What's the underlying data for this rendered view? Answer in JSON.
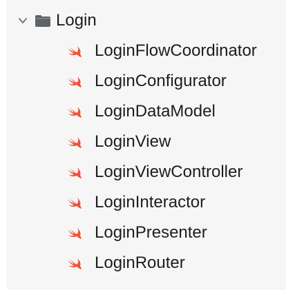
{
  "navigator": {
    "folder": {
      "label": "Login",
      "expanded": true,
      "icon": "folder-icon",
      "disclosure_icon": "chevron-down-icon"
    },
    "files": [
      {
        "label": "LoginFlowCoordinator",
        "icon": "swift-icon"
      },
      {
        "label": "LoginConfigurator",
        "icon": "swift-icon"
      },
      {
        "label": "LoginDataModel",
        "icon": "swift-icon"
      },
      {
        "label": "LoginView",
        "icon": "swift-icon"
      },
      {
        "label": "LoginViewController",
        "icon": "swift-icon"
      },
      {
        "label": "LoginInteractor",
        "icon": "swift-icon"
      },
      {
        "label": "LoginPresenter",
        "icon": "swift-icon"
      },
      {
        "label": "LoginRouter",
        "icon": "swift-icon"
      }
    ]
  },
  "colors": {
    "background": "#f6f6f6",
    "text": "#1d1d1f",
    "folder": "#5f6368",
    "swift": "#f05138"
  }
}
